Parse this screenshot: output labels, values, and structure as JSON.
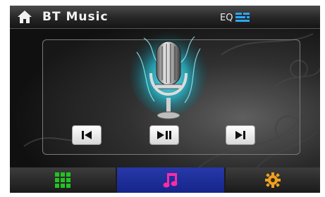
{
  "header": {
    "title": "BT Music",
    "eq_label": "EQ"
  },
  "controls": {
    "prev": "previous-track",
    "play_pause": "play-pause",
    "next": "next-track"
  },
  "bottom_tabs": [
    {
      "name": "apps",
      "icon": "grid-icon",
      "active": false
    },
    {
      "name": "music",
      "icon": "music-note-icon",
      "active": true
    },
    {
      "name": "settings",
      "icon": "gear-icon",
      "active": false
    }
  ],
  "colors": {
    "accent_blue": "#1a2a9a",
    "grid_green": "#22c322",
    "note_magenta": "#ff2aa8",
    "gear_orange": "#f0a020",
    "eq_blue": "#2aa8ff",
    "glow_cyan": "#33ddee"
  }
}
